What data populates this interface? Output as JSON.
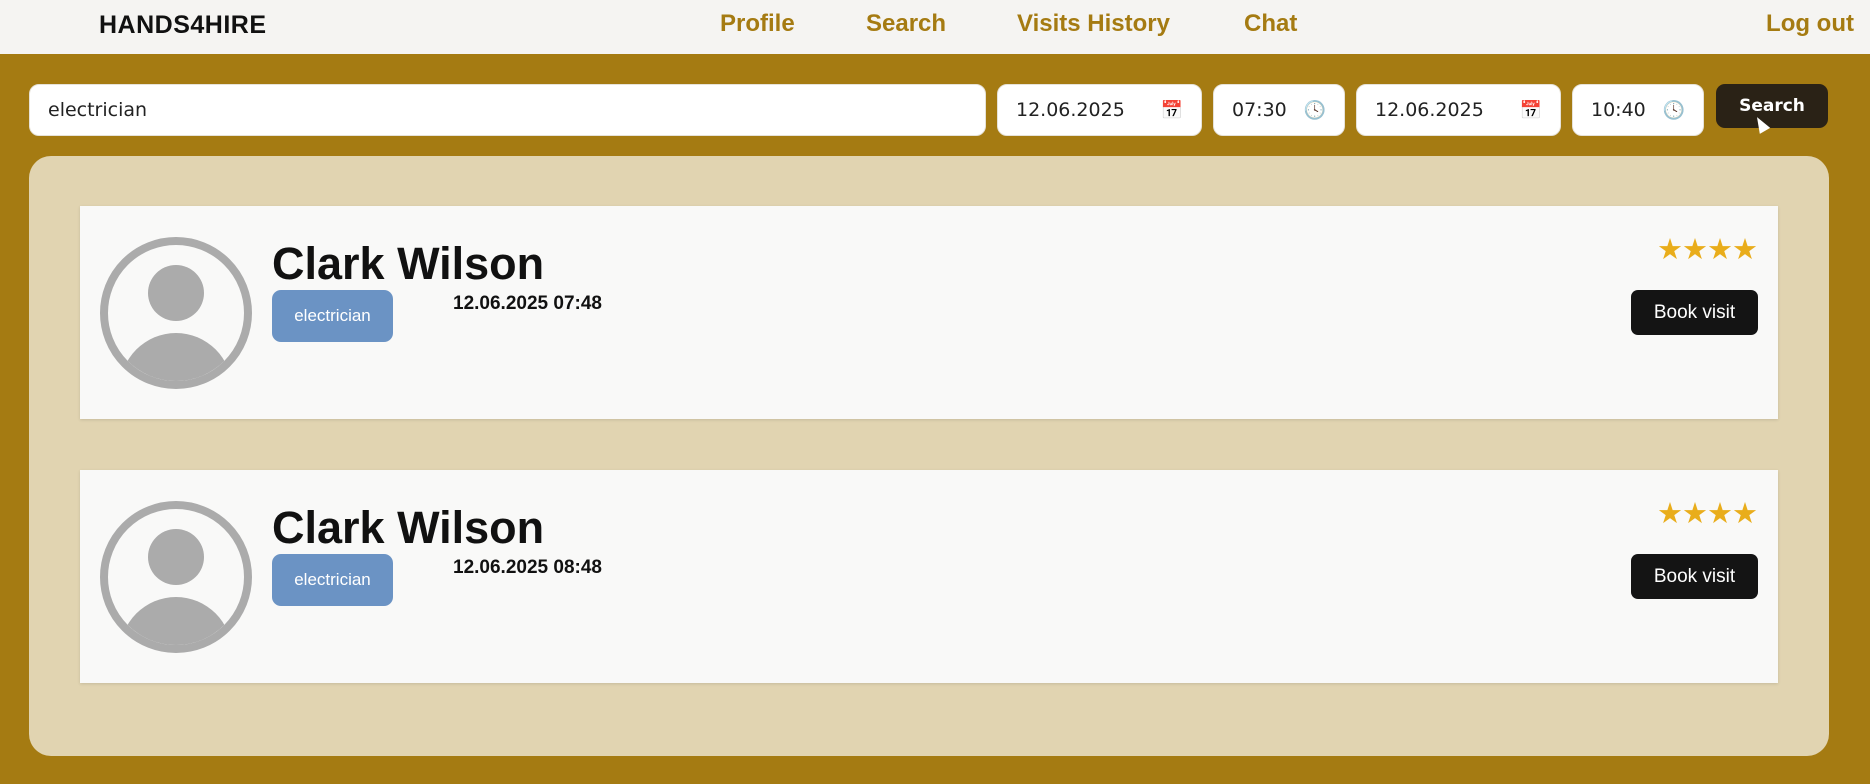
{
  "nav": {
    "brand": "HANDS4HIRE",
    "links": [
      "Profile",
      "Search",
      "Visits History",
      "Chat"
    ],
    "logout": "Log out"
  },
  "search": {
    "keyword": "electrician",
    "from_date": "12.06.2025",
    "from_time": "07:30",
    "to_date": "12.06.2025",
    "to_time": "10:40",
    "button_label": "Search",
    "calendar_icon": "calendar-icon",
    "clock_icon": "clock-icon"
  },
  "results": [
    {
      "name": "Clark Wilson",
      "specialty": "electrician",
      "datetime": "12.06.2025 07:48",
      "rating_stars": "★★★★",
      "rating": 4,
      "book_label": "Book visit"
    },
    {
      "name": "Clark Wilson",
      "specialty": "electrician",
      "datetime": "12.06.2025 08:48",
      "rating_stars": "★★★★",
      "rating": 4,
      "book_label": "Book visit"
    }
  ],
  "colors": {
    "background": "#a57b12",
    "panel": "#e1d4b1",
    "nav_link": "#a57b12",
    "specialty_badge": "#6b93c4",
    "star": "#e9ad1b"
  }
}
